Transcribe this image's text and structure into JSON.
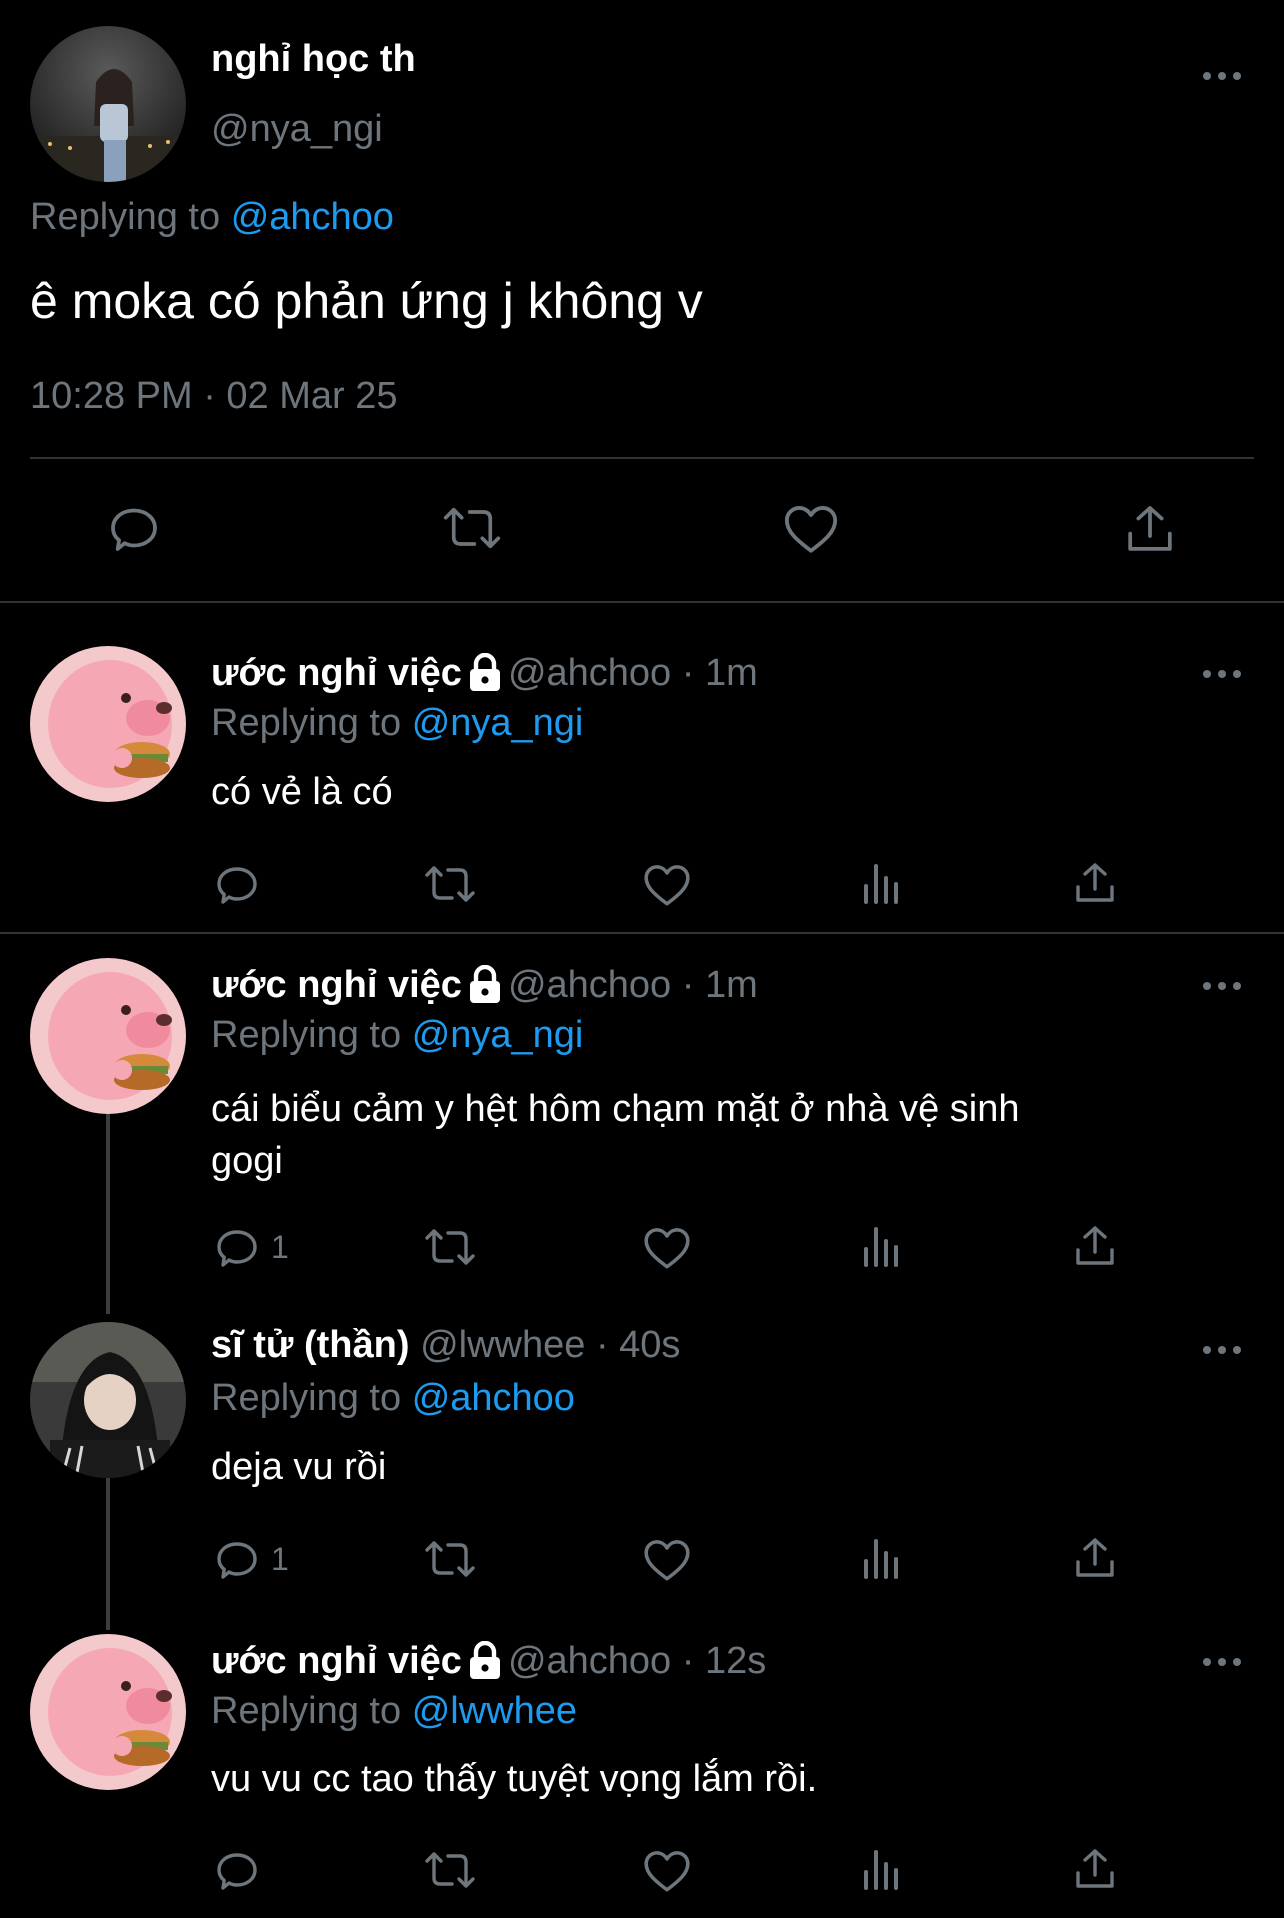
{
  "main_tweet": {
    "display_name": "nghỉ học th",
    "handle": "@nya_ngi",
    "replying_prefix": "Replying to",
    "replying_to": "@ahchoo",
    "text": "ê moka có phản ứng j không v",
    "timestamp": "10:28 PM · 02 Mar 25"
  },
  "replies": [
    {
      "display_name": "ước nghỉ việc",
      "handle": "@ahchoo",
      "time": "· 1m",
      "replying_prefix": "Replying to",
      "replying_to": "@nya_ngi",
      "text": "có vẻ là có",
      "reply_count": ""
    },
    {
      "display_name": "ước nghỉ việc",
      "handle": "@ahchoo",
      "time": "· 1m",
      "replying_prefix": "Replying to",
      "replying_to": "@nya_ngi",
      "text_line1": "cái biểu cảm y hệt hôm chạm mặt ở nhà vệ sinh",
      "text_line2": "gogi",
      "reply_count": "1"
    },
    {
      "display_name": "sĩ tử (thần)",
      "handle": "@lwwhee",
      "time": "· 40s",
      "replying_prefix": "Replying to",
      "replying_to": "@ahchoo",
      "text": "deja vu rồi",
      "reply_count": "1"
    },
    {
      "display_name": "ước nghỉ việc",
      "handle": "@ahchoo",
      "time": "· 12s",
      "replying_prefix": "Replying to",
      "replying_to": "@lwwhee",
      "text": "vu vu cc tao thấy tuyệt vọng lắm rồi.",
      "reply_count": ""
    }
  ],
  "icons": [
    "more-icon",
    "reply-icon",
    "retweet-icon",
    "like-icon",
    "views-icon",
    "share-icon",
    "lock-icon"
  ],
  "colors": {
    "background": "#000000",
    "link": "#1d9bf0",
    "muted": "#6e767d",
    "divider": "#2f3336"
  }
}
